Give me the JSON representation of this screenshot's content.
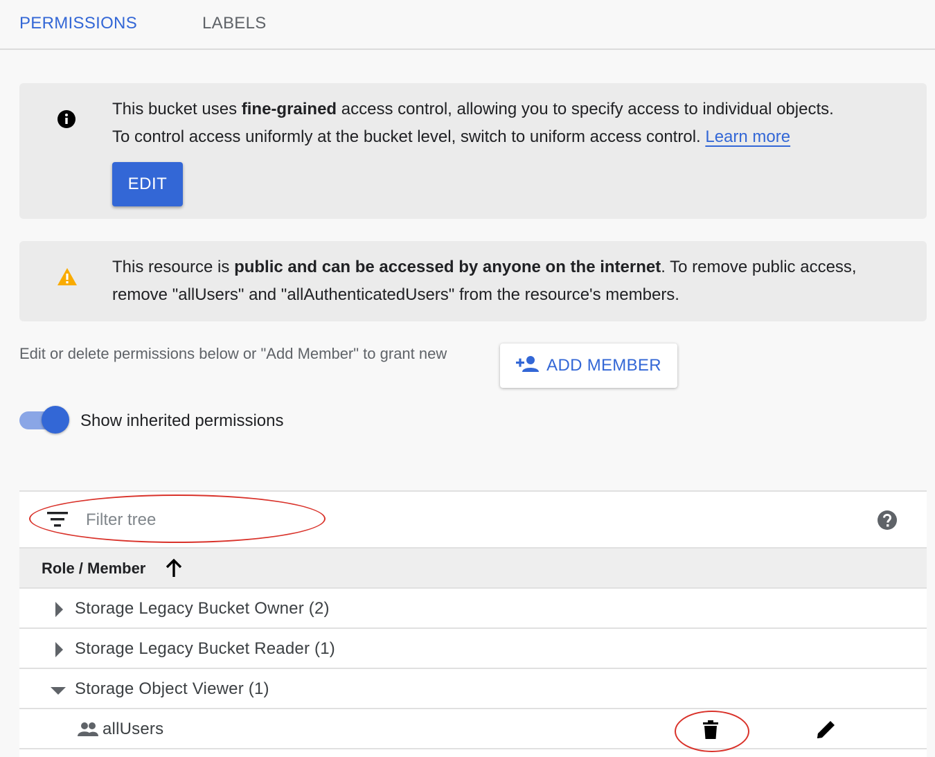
{
  "tabs": [
    {
      "label": "PERMISSIONS",
      "active": true
    },
    {
      "label": "LABELS",
      "active": false
    }
  ],
  "info_banner": {
    "line1_pre": "This bucket uses ",
    "line1_bold": "fine-grained",
    "line1_post": " access control, allowing you to specify access to individual objects.",
    "line2": "To control access uniformly at the bucket level, switch to uniform access control. ",
    "link": "Learn more",
    "button": "EDIT"
  },
  "warning_banner": {
    "pre": "This resource is ",
    "bold": "public and can be accessed by anyone on the internet",
    "post": ". To remove public access, remove \"allUsers\" and \"allAuthenticatedUsers\" from the resource's members."
  },
  "helper_text": "Edit or delete permissions below or \"Add Member\" to grant new",
  "add_member_button": "ADD MEMBER",
  "toggle": {
    "label": "Show inherited permissions",
    "on": true
  },
  "filter": {
    "placeholder": "Filter tree"
  },
  "table": {
    "header": "Role / Member",
    "rows": [
      {
        "label": "Storage Legacy Bucket Owner (2)",
        "expanded": false
      },
      {
        "label": "Storage Legacy Bucket Reader (1)",
        "expanded": false
      },
      {
        "label": "Storage Object Viewer (1)",
        "expanded": true
      }
    ],
    "members": [
      {
        "label": "allUsers"
      }
    ]
  },
  "colors": {
    "accent": "#3367d6",
    "warning": "#f9ab00",
    "annotation": "#d9322a"
  }
}
